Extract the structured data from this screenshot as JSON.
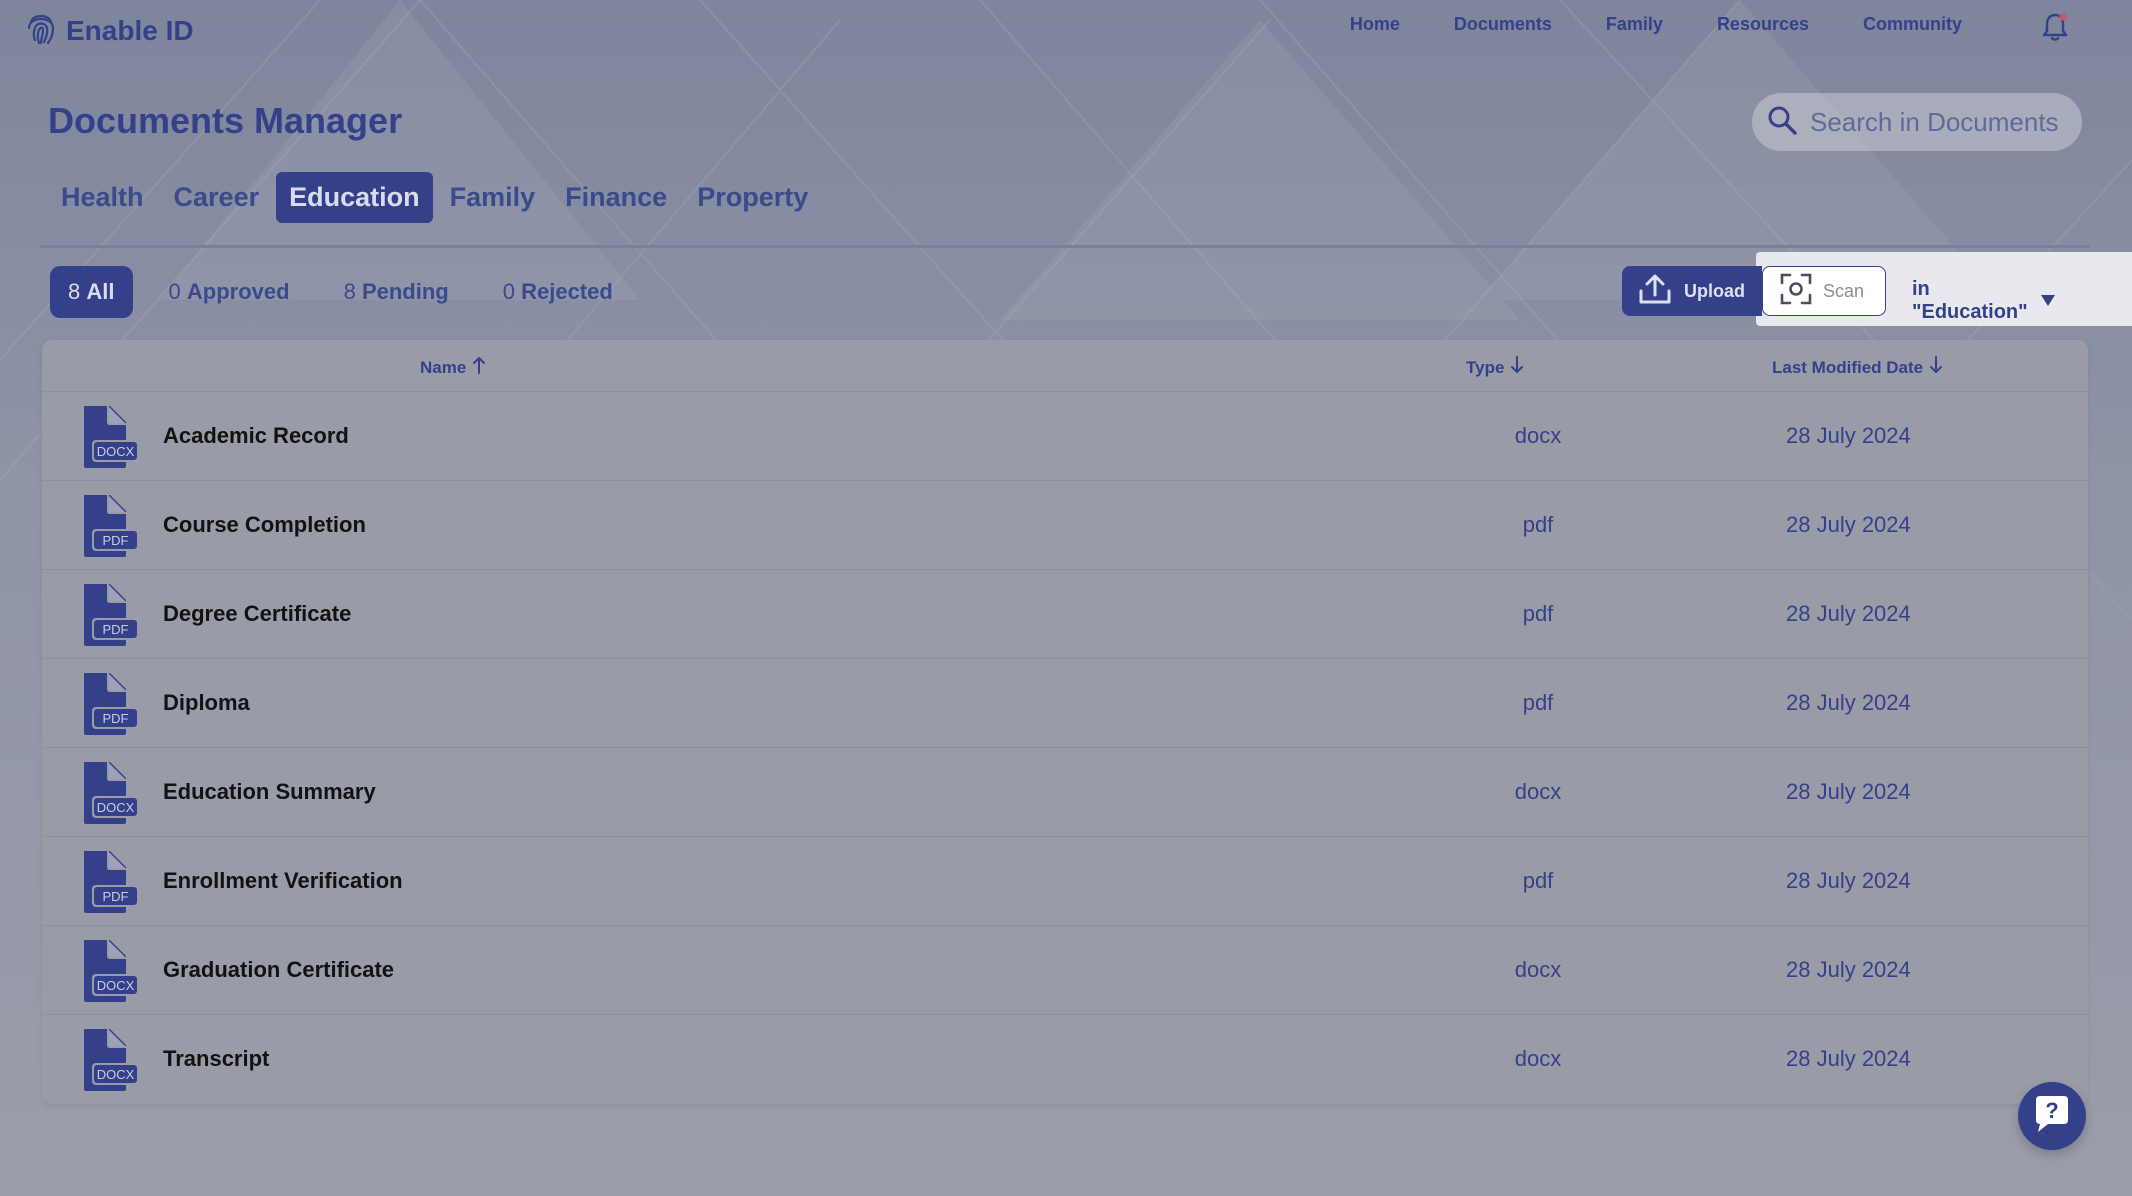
{
  "app": {
    "title": "Enable ID"
  },
  "nav": {
    "links": [
      "Home",
      "Documents",
      "Family",
      "Resources",
      "Community"
    ]
  },
  "page": {
    "title": "Documents Manager"
  },
  "search": {
    "placeholder": "Search in Documents"
  },
  "tabs": [
    {
      "label": "Health",
      "active": false
    },
    {
      "label": "Career",
      "active": false
    },
    {
      "label": "Education",
      "active": true
    },
    {
      "label": "Family",
      "active": false
    },
    {
      "label": "Finance",
      "active": false
    },
    {
      "label": "Property",
      "active": false
    }
  ],
  "filters": [
    {
      "count": "8",
      "label": "All",
      "active": true
    },
    {
      "count": "0",
      "label": "Approved",
      "active": false
    },
    {
      "count": "8",
      "label": "Pending",
      "active": false
    },
    {
      "count": "0",
      "label": "Rejected",
      "active": false
    }
  ],
  "actions": {
    "upload_label": "Upload",
    "scan_label": "Scan",
    "scope_label": "in \"Education\""
  },
  "table": {
    "columns": {
      "name": "Name",
      "type": "Type",
      "date": "Last Modified Date"
    },
    "rows": [
      {
        "name": "Academic Record",
        "type": "docx",
        "badge": "DOCX",
        "date": "28 July 2024"
      },
      {
        "name": "Course Completion",
        "type": "pdf",
        "badge": "PDF",
        "date": "28 July 2024"
      },
      {
        "name": "Degree Certificate",
        "type": "pdf",
        "badge": "PDF",
        "date": "28 July 2024"
      },
      {
        "name": "Diploma",
        "type": "pdf",
        "badge": "PDF",
        "date": "28 July 2024"
      },
      {
        "name": "Education Summary",
        "type": "docx",
        "badge": "DOCX",
        "date": "28 July 2024"
      },
      {
        "name": "Enrollment Verification",
        "type": "pdf",
        "badge": "PDF",
        "date": "28 July 2024"
      },
      {
        "name": "Graduation Certificate",
        "type": "docx",
        "badge": "DOCX",
        "date": "28 July 2024"
      },
      {
        "name": "Transcript",
        "type": "docx",
        "badge": "DOCX",
        "date": "28 July 2024"
      }
    ]
  },
  "colors": {
    "accent": "#34418a",
    "background": "#8d93a6",
    "panel": "#999ca7"
  },
  "icons": {
    "logo": "fingerprint-icon",
    "bell": "bell-icon",
    "search": "search-icon",
    "upload": "upload-icon",
    "scan": "scan-icon",
    "dropdown": "caret-down-icon",
    "help": "help-icon"
  }
}
